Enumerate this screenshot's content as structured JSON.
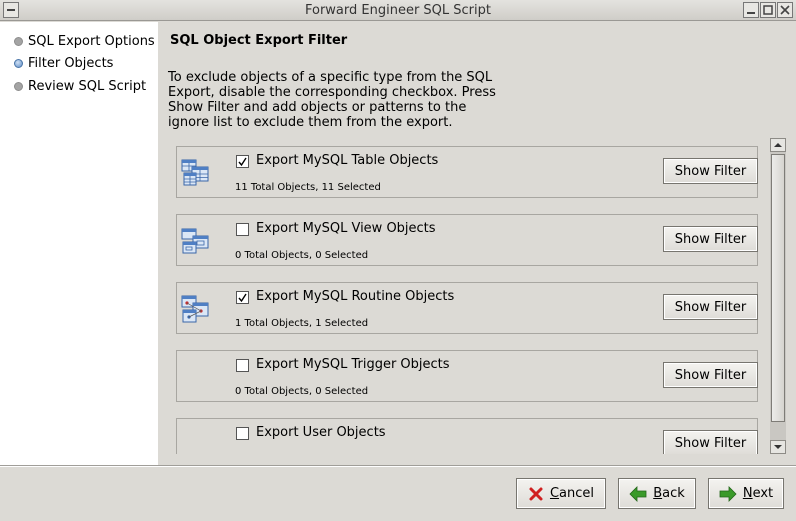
{
  "window": {
    "title": "Forward Engineer SQL Script"
  },
  "sidebar": {
    "steps": [
      {
        "label": "SQL Export Options",
        "state": "done"
      },
      {
        "label": "Filter Objects",
        "state": "active"
      },
      {
        "label": "Review SQL Script",
        "state": "pending"
      }
    ]
  },
  "main": {
    "heading": "SQL Object Export Filter",
    "description": "To exclude objects of a specific type from the SQL Export, disable the corresponding checkbox. Press Show Filter and add objects or patterns to the ignore list to exclude them from the export.",
    "groups": [
      {
        "icon": "table-objects-icon",
        "label": "Export MySQL Table Objects",
        "checked": true,
        "count": "11 Total Objects, 11 Selected",
        "button": "Show Filter"
      },
      {
        "icon": "view-objects-icon",
        "label": "Export MySQL View Objects",
        "checked": false,
        "count": "0 Total Objects, 0 Selected",
        "button": "Show Filter"
      },
      {
        "icon": "routine-objects-icon",
        "label": "Export MySQL Routine Objects",
        "checked": true,
        "count": "1 Total Objects, 1 Selected",
        "button": "Show Filter"
      },
      {
        "icon": "",
        "label": "Export MySQL Trigger Objects",
        "checked": false,
        "count": "0 Total Objects, 0 Selected",
        "button": "Show Filter"
      },
      {
        "icon": "",
        "label": "Export User Objects",
        "checked": false,
        "count": "",
        "button": "Show Filter"
      }
    ]
  },
  "footer": {
    "cancel_prefix": "",
    "cancel_mnemonic": "C",
    "cancel_rest": "ancel",
    "back_prefix": "",
    "back_mnemonic": "B",
    "back_rest": "ack",
    "next_prefix": "",
    "next_mnemonic": "N",
    "next_rest": "ext"
  },
  "colors": {
    "active_step": "#5f8ec7",
    "cancel_icon": "#d02020",
    "nav_arrow": "#3a9a2a"
  }
}
